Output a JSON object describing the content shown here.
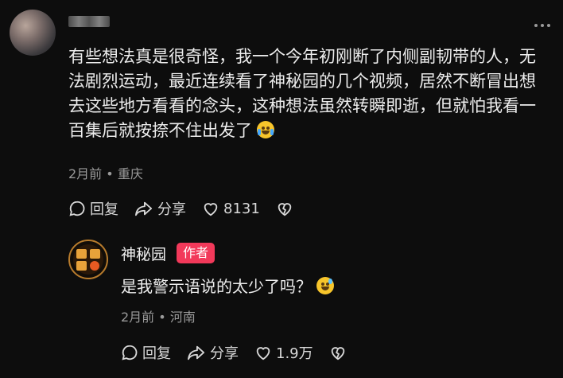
{
  "comment": {
    "text": "有些想法真是很奇怪，我一个今年初刚断了内侧副韧带的人，无法剧烈运动，最近连续看了神秘园的几个视频，居然不断冒出想去这些地方看看的念头，这种想法虽然转瞬即逝，但就怕我看一百集后就按捺不住出发了",
    "emoji_icon": "laughing-crying-emoji",
    "time": "2月前",
    "location": "重庆",
    "actions": {
      "reply_label": "回复",
      "share_label": "分享",
      "likes": "8131"
    }
  },
  "reply": {
    "author": "神秘园",
    "badge": "作者",
    "text": "是我警示语说的太少了吗？",
    "emoji_icon": "sweat-smile-emoji",
    "time": "2月前",
    "location": "河南",
    "actions": {
      "reply_label": "回复",
      "share_label": "分享",
      "likes": "1.9万"
    }
  },
  "colors": {
    "background": "#0d0d0d",
    "badge": "#f2395a",
    "meta_text": "#9a9a9a"
  }
}
